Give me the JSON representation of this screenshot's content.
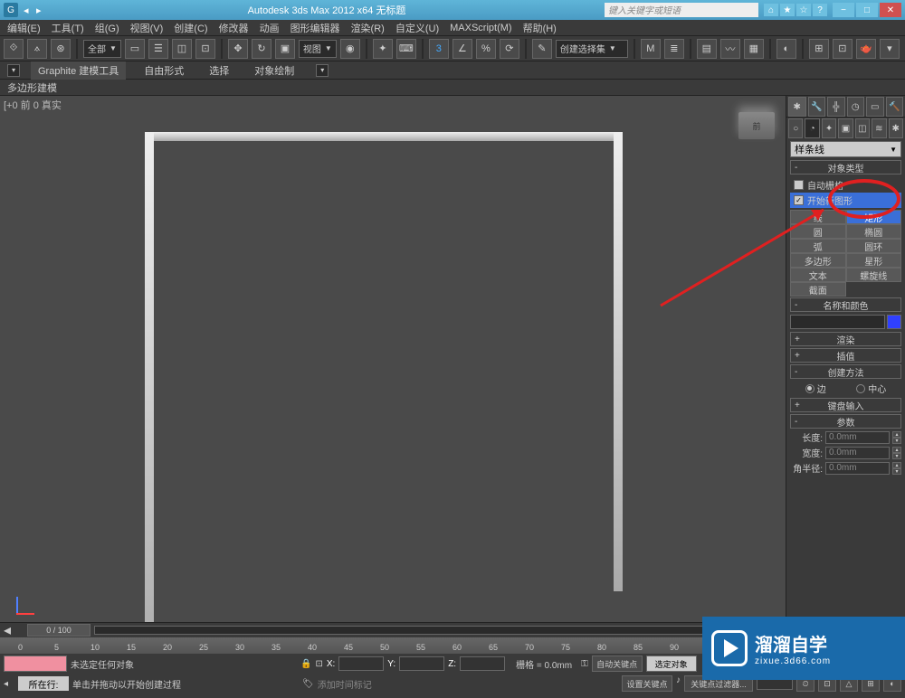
{
  "title": "Autodesk 3ds Max 2012 x64   无标题",
  "search_placeholder": "键入关键字或短语",
  "menu": [
    "编辑(E)",
    "工具(T)",
    "组(G)",
    "视图(V)",
    "创建(C)",
    "修改器",
    "动画",
    "图形编辑器",
    "渲染(R)",
    "自定义(U)",
    "MAXScript(M)",
    "帮助(H)"
  ],
  "toolbar": {
    "combo_all": "全部",
    "view_combo": "视图",
    "selection_set": "创建选择集"
  },
  "ribbon": {
    "title": "Graphite 建模工具",
    "tabs": [
      "自由形式",
      "选择",
      "对象绘制"
    ],
    "sublabel": "多边形建模"
  },
  "viewport_label": "[+0 前 0 真实",
  "viewcube": "前",
  "cmdpanel": {
    "dropdown": "样条线",
    "rollouts": {
      "object_type": "对象类型",
      "auto_grid": "自动栅格",
      "start_new": "开始新图形",
      "shapes": {
        "line": "线",
        "rectangle": "矩形",
        "circle": "圆",
        "ellipse": "椭圆",
        "arc": "弧",
        "donut": "圆环",
        "ngon": "多边形",
        "star": "星形",
        "text": "文本",
        "helix": "螺旋线",
        "section": "截面"
      },
      "name_color": "名称和颜色",
      "render": "渲染",
      "interpolation": "插值",
      "creation_method": "创建方法",
      "radio_edge": "边",
      "radio_center": "中心",
      "keyboard": "键盘输入",
      "parameters": "参数",
      "length": "长度:",
      "width": "宽度:",
      "corner_radius": "角半径:",
      "default_val": "0.0mm"
    }
  },
  "timeline": {
    "slider": "0 / 100",
    "ticks": [
      "0",
      "5",
      "10",
      "15",
      "20",
      "25",
      "30",
      "35",
      "40",
      "45",
      "50",
      "55",
      "60",
      "65",
      "70",
      "75",
      "80",
      "85",
      "90"
    ],
    "status1": "未选定任何对象",
    "status2": "单击并拖动以开始创建过程",
    "add_time_tag": "添加时间标记",
    "lattice": "栅格 = 0.0mm",
    "autokey": "自动关键点",
    "setkey": "设置关键点",
    "selected": "选定对象",
    "keyfilter": "关键点过滤器...",
    "location_row": "所在行:"
  },
  "watermark": {
    "big": "溜溜自学",
    "small": "zixue.3d66.com"
  }
}
